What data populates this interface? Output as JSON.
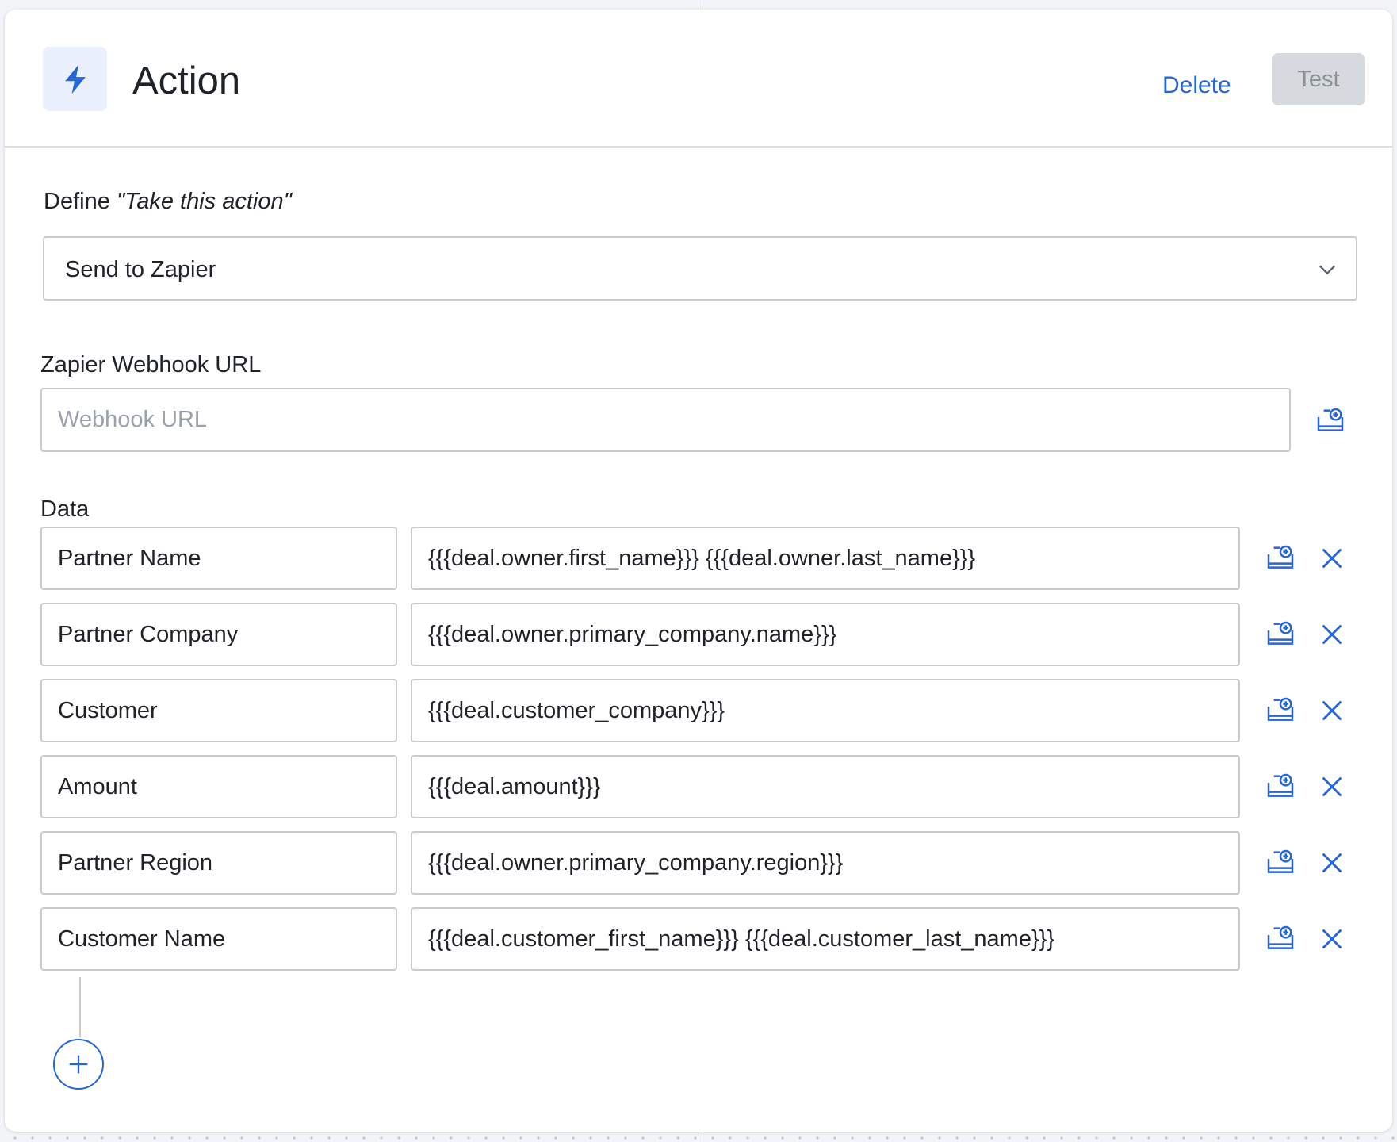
{
  "header": {
    "icon": "lightning-bolt-icon",
    "title": "Action",
    "delete_label": "Delete",
    "test_label": "Test"
  },
  "define": {
    "label_prefix": "Define ",
    "label_italic": "\"Take this action\"",
    "selected": "Send to Zapier"
  },
  "webhook": {
    "label": "Zapier Webhook URL",
    "placeholder": "Webhook URL",
    "value": ""
  },
  "data_section": {
    "label": "Data",
    "rows": [
      {
        "key": "Partner Name",
        "value": "{{{deal.owner.first_name}}} {{{deal.owner.last_name}}}"
      },
      {
        "key": "Partner Company",
        "value": "{{{deal.owner.primary_company.name}}}"
      },
      {
        "key": "Customer",
        "value": "{{{deal.customer_company}}}"
      },
      {
        "key": "Amount",
        "value": "{{{deal.amount}}}"
      },
      {
        "key": "Partner Region",
        "value": "{{{deal.owner.primary_company.region}}}"
      },
      {
        "key": "Customer Name",
        "value": "{{{deal.customer_first_name}}} {{{deal.customer_last_name}}}"
      }
    ]
  },
  "colors": {
    "accent": "#2565d8",
    "icon_bg": "#eaf0fd",
    "disabled_bg": "#d6d9de",
    "border": "#c8ccd2"
  }
}
